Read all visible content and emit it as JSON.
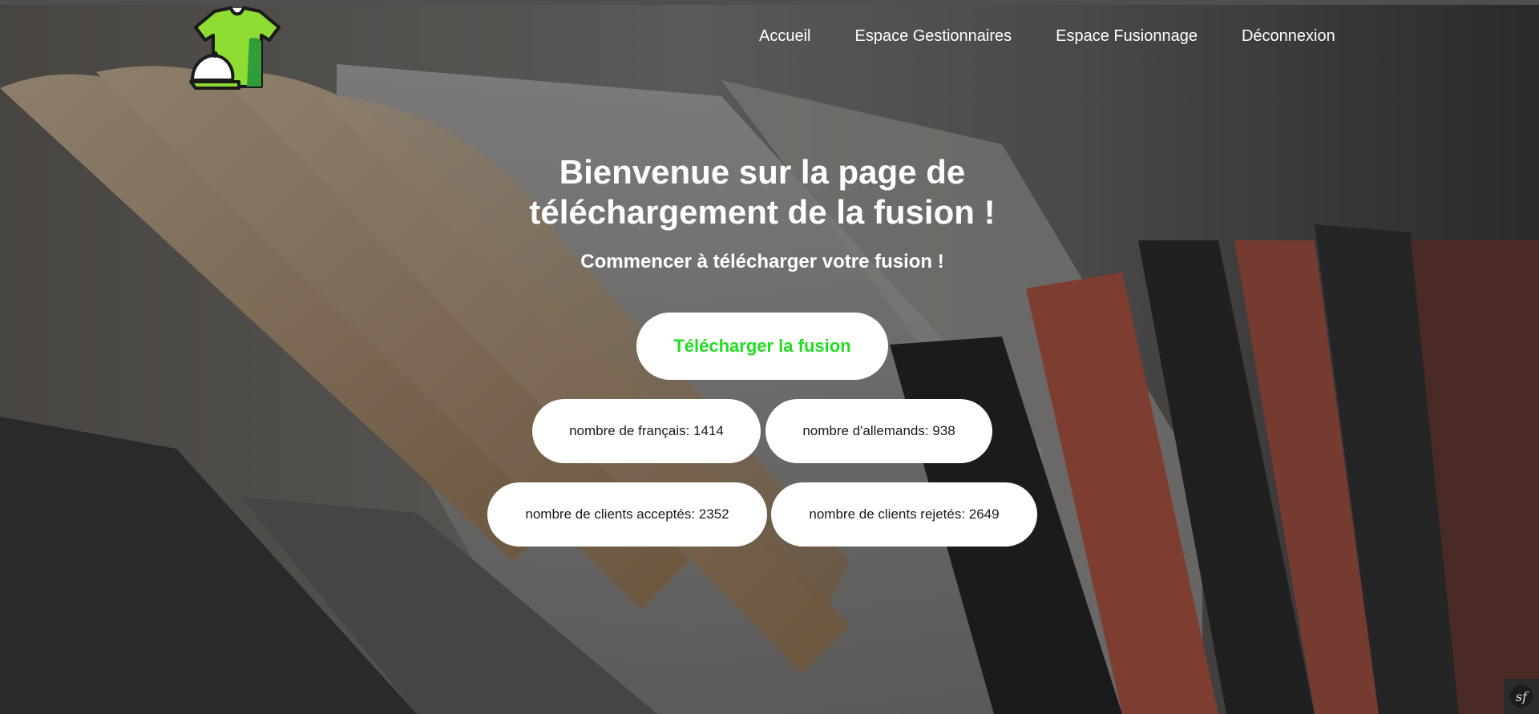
{
  "nav": {
    "items": [
      {
        "label": "Accueil"
      },
      {
        "label": "Espace Gestionnaires"
      },
      {
        "label": "Espace Fusionnage"
      },
      {
        "label": "Déconnexion"
      }
    ]
  },
  "hero": {
    "title": "Bienvenue sur la page de téléchargement de la fusion !",
    "subtitle": "Commencer à télécharger votre fusion !",
    "download_label": "Télécharger la fusion"
  },
  "stats": {
    "french": "nombre de français: 1414",
    "german": "nombre d'allemands: 938",
    "accepted": "nombre de clients acceptés: 2352",
    "rejected": "nombre de clients rejetés: 2649"
  },
  "colors": {
    "accent_green": "#22dd22",
    "logo_green": "#8fdc32"
  },
  "icons": {
    "logo": "tshirt-cap-logo-icon",
    "debug": "symfony-icon"
  }
}
